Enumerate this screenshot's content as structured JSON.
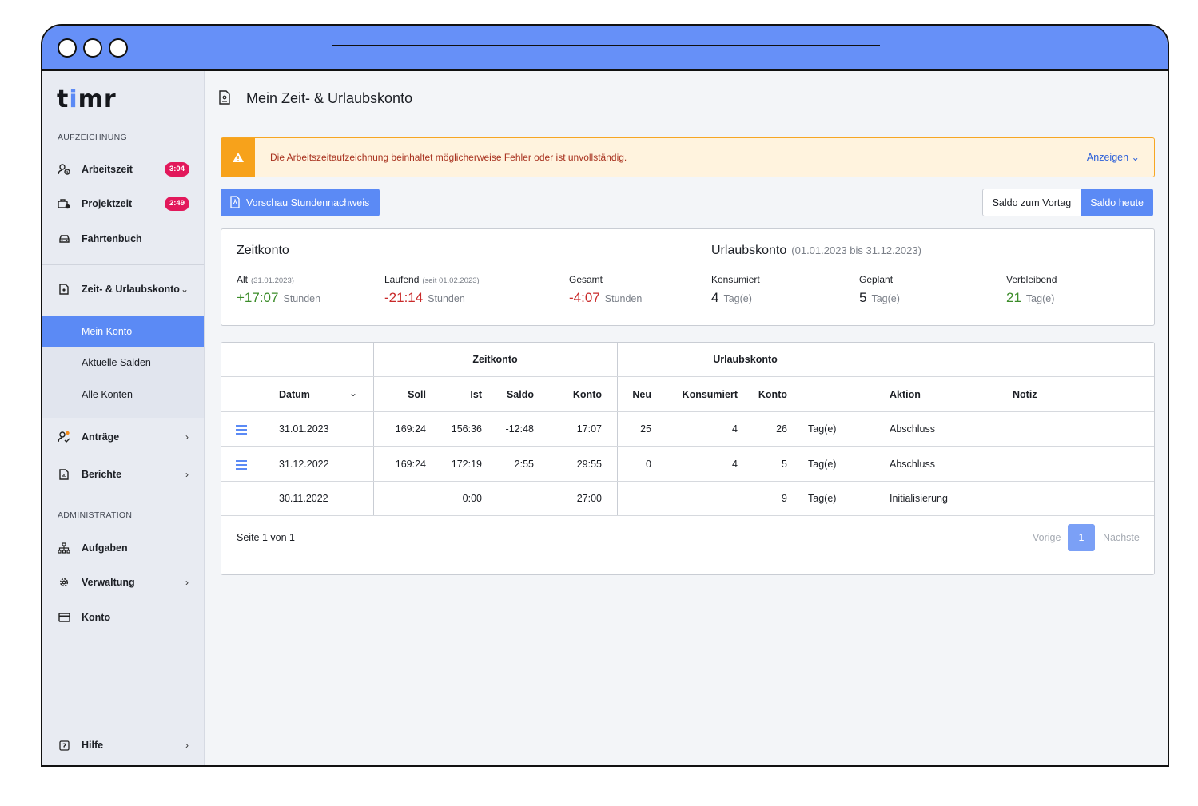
{
  "app": {
    "logo_pre": "t",
    "logo_i": "i",
    "logo_post": "mr"
  },
  "sidebar": {
    "section_recording": "AUFZEICHNUNG",
    "section_admin": "ADMINISTRATION",
    "items": [
      {
        "label": "Arbeitszeit",
        "badge": "3:04",
        "icon": "user-clock-icon"
      },
      {
        "label": "Projektzeit",
        "badge": "2:49",
        "icon": "briefcase-clock-icon"
      },
      {
        "label": "Fahrtenbuch",
        "icon": "car-icon"
      },
      {
        "label": "Zeit- & Urlaubskonto",
        "chevron": "⌄",
        "icon": "document-icon"
      },
      {
        "label": "Anträge",
        "chevron": "›",
        "icon": "user-check-icon"
      },
      {
        "label": "Berichte",
        "chevron": "›",
        "icon": "report-icon"
      },
      {
        "label": "Aufgaben",
        "icon": "hierarchy-icon"
      },
      {
        "label": "Verwaltung",
        "chevron": "›",
        "icon": "gear-icon"
      },
      {
        "label": "Konto",
        "icon": "credit-card-icon"
      },
      {
        "label": "Hilfe",
        "chevron": "›",
        "icon": "help-icon"
      }
    ],
    "subitems": [
      "Mein Konto",
      "Aktuelle Salden",
      "Alle Konten"
    ]
  },
  "page": {
    "title": "Mein Zeit- & Urlaubskonto"
  },
  "alert": {
    "text": "Die Arbeitszeitaufzeichnung beinhaltet möglicherweise Fehler oder ist unvollständig.",
    "link": "Anzeigen ⌄"
  },
  "toolbar": {
    "preview_label": "Vorschau Stundennachweis",
    "saldo_vortag": "Saldo zum Vortag",
    "saldo_heute": "Saldo heute"
  },
  "summary": {
    "zeitkonto_title": "Zeitkonto",
    "urlaubskonto_title": "Urlaubskonto",
    "urlaubskonto_range": "(01.01.2023 bis 31.12.2023)",
    "alt": {
      "label": "Alt",
      "sub": "(31.01.2023)",
      "value": "+17:07",
      "unit": "Stunden"
    },
    "laufend": {
      "label": "Laufend",
      "sub": "(seit 01.02.2023)",
      "value": "-21:14",
      "unit": "Stunden"
    },
    "gesamt": {
      "label": "Gesamt",
      "value": "-4:07",
      "unit": "Stunden"
    },
    "konsumiert": {
      "label": "Konsumiert",
      "value": "4",
      "unit": "Tag(e)"
    },
    "geplant": {
      "label": "Geplant",
      "value": "5",
      "unit": "Tag(e)"
    },
    "verbleibend": {
      "label": "Verbleibend",
      "value": "21",
      "unit": "Tag(e)"
    }
  },
  "table": {
    "group_zeitkonto": "Zeitkonto",
    "group_urlaubskonto": "Urlaubskonto",
    "headers": {
      "datum": "Datum",
      "soll": "Soll",
      "ist": "Ist",
      "saldo": "Saldo",
      "konto": "Konto",
      "neu": "Neu",
      "konsumiert": "Konsumiert",
      "ukonto": "Konto",
      "aktion": "Aktion",
      "notiz": "Notiz"
    },
    "rows": [
      {
        "datum": "31.01.2023",
        "soll": "169:24",
        "ist": "156:36",
        "saldo": "-12:48",
        "konto": "17:07",
        "neu": "25",
        "konsumiert": "4",
        "ukonto": "26",
        "unit": "Tag(e)",
        "aktion": "Abschluss"
      },
      {
        "datum": "31.12.2022",
        "soll": "169:24",
        "ist": "172:19",
        "saldo": "2:55",
        "konto": "29:55",
        "neu": "0",
        "konsumiert": "4",
        "ukonto": "5",
        "unit": "Tag(e)",
        "aktion": "Abschluss"
      },
      {
        "datum": "30.11.2022",
        "soll": "",
        "ist": "0:00",
        "saldo": "",
        "konto": "27:00",
        "neu": "",
        "konsumiert": "",
        "ukonto": "9",
        "unit": "Tag(e)",
        "aktion": "Initialisierung"
      }
    ],
    "footer": {
      "page_info": "Seite 1 von 1",
      "prev": "Vorige",
      "current": "1",
      "next": "Nächste"
    }
  }
}
